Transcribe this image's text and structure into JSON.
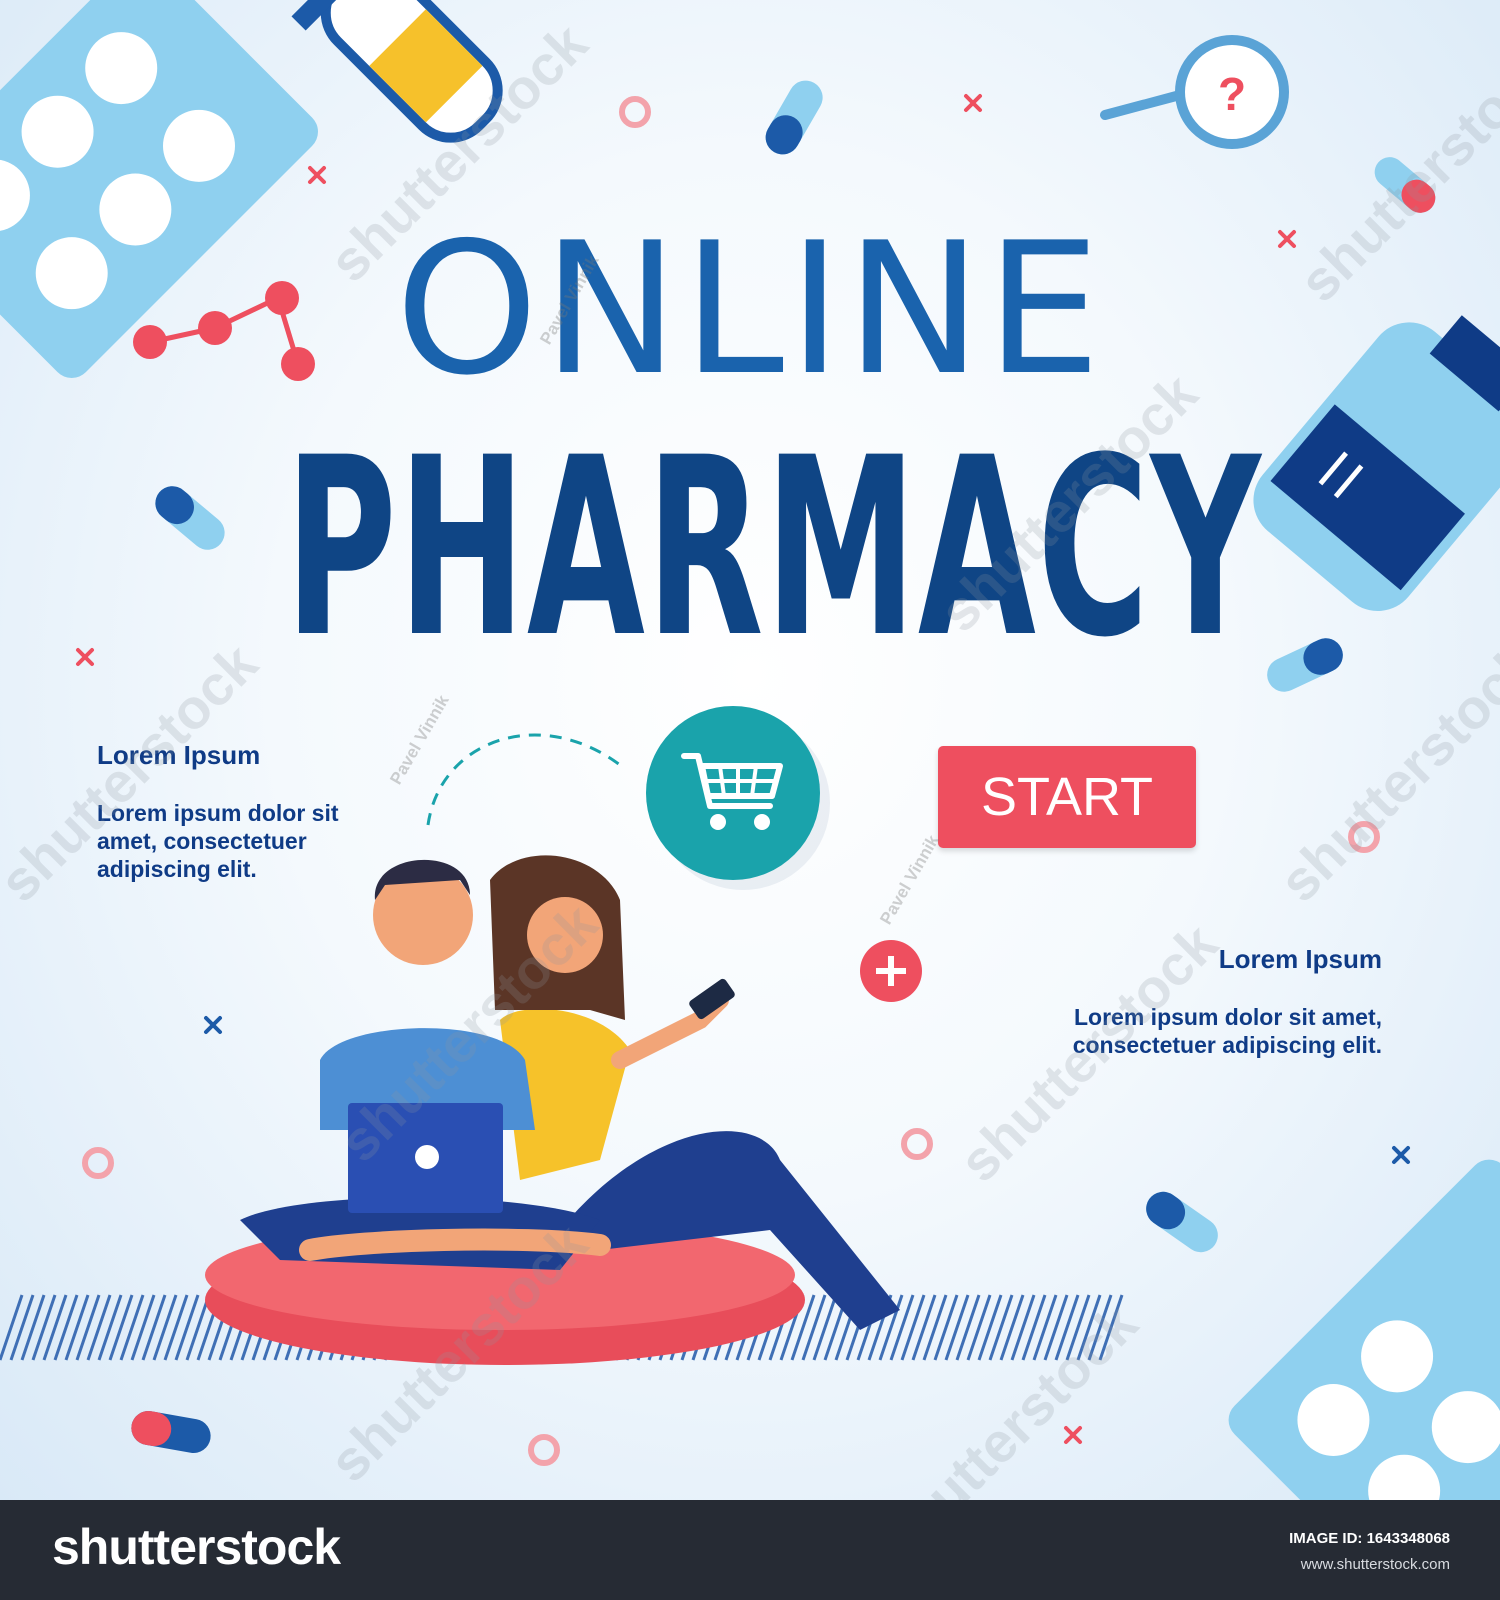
{
  "banner": {
    "title_line1": "ONLINE",
    "title_line2": "PHARMACY",
    "start_button_label": "START",
    "left_block": {
      "heading": "Lorem Ipsum",
      "body": "Lorem ipsum dolor sit amet, consectetuer adipiscing elit."
    },
    "right_block": {
      "heading": "Lorem Ipsum",
      "body": "Lorem ipsum dolor sit amet, consectetuer adipiscing elit."
    },
    "question_mark": "?",
    "icons": [
      "cart-icon",
      "plus-icon",
      "magnifier-icon",
      "pill-blister-icon",
      "test-tube-icon",
      "capsule-icon",
      "medicine-bottle-icon",
      "molecule-icon"
    ]
  },
  "watermark": {
    "text": "shutterstock",
    "author": "Pavel Vinnik"
  },
  "footer": {
    "logo": "shutterstock",
    "image_id_label": "IMAGE ID: 1643348068",
    "url": "www.shutterstock.com"
  },
  "colors": {
    "title_light": "#1a63ad",
    "title_dark": "#0f4585",
    "accent_red": "#ee4f5f",
    "cart_teal": "#1aa3ab",
    "footer_bg": "#262b34"
  }
}
